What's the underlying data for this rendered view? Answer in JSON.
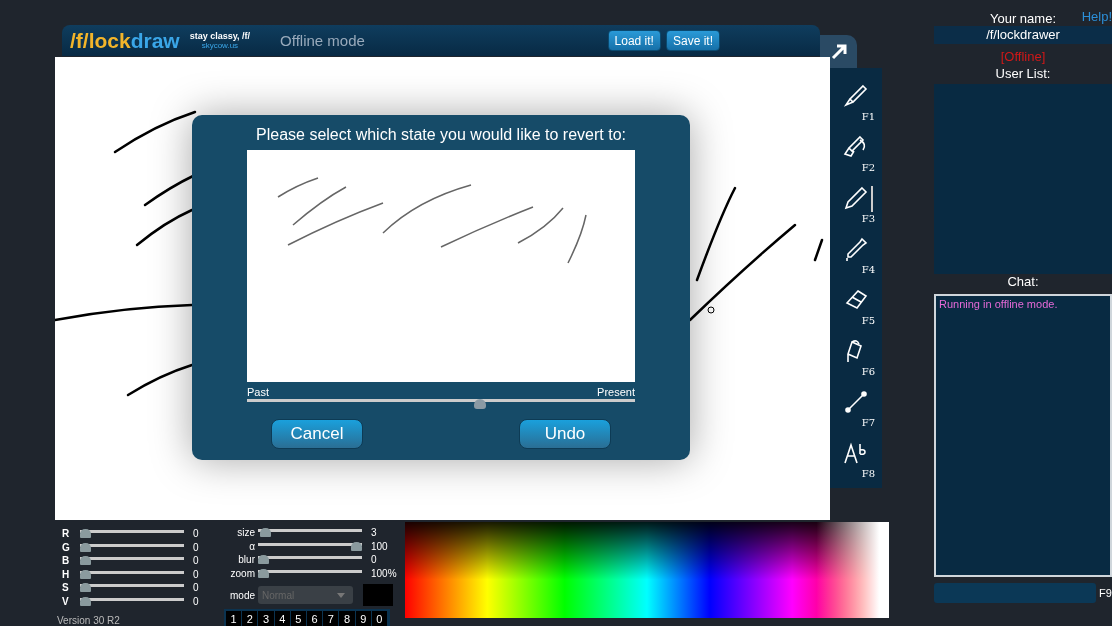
{
  "header": {
    "logo": [
      {
        "text": "/f/lock",
        "color": "#f2b52a"
      },
      {
        "text": "draw",
        "color": "#3aa6e8"
      }
    ],
    "tagline": "stay classy, /f/",
    "site": "skycow.us",
    "mode": "Offline mode",
    "buttons": [
      "Load it!",
      "Save it!"
    ]
  },
  "tools": [
    {
      "key": "F1",
      "kind": "brush",
      "selected": false
    },
    {
      "key": "F2",
      "kind": "smudge",
      "selected": false
    },
    {
      "key": "F3",
      "kind": "pencil",
      "selected": true
    },
    {
      "key": "F4",
      "kind": "dropper",
      "selected": false
    },
    {
      "key": "F5",
      "kind": "eraser",
      "selected": false
    },
    {
      "key": "F6",
      "kind": "bucket",
      "selected": false
    },
    {
      "key": "F7",
      "kind": "line",
      "selected": false
    },
    {
      "key": "F8",
      "kind": "text",
      "selected": false
    }
  ],
  "dialog": {
    "title": "Please select which state you would like to revert to:",
    "start_label": "Past",
    "end_label": "Present",
    "level": 0.6,
    "buttons": [
      "Cancel",
      "Undo"
    ]
  },
  "color_sliders": [
    {
      "label": "R",
      "level": 0,
      "reading": "0"
    },
    {
      "label": "G",
      "level": 0,
      "reading": "0"
    },
    {
      "label": "B",
      "level": 0,
      "reading": "0"
    },
    {
      "label": "H",
      "level": 0,
      "reading": "0"
    },
    {
      "label": "S",
      "level": 0,
      "reading": "0"
    },
    {
      "label": "V",
      "level": 0,
      "reading": "0"
    }
  ],
  "brush_sliders": [
    {
      "label": "size",
      "level": 0.02,
      "reading": "3"
    },
    {
      "label": "α",
      "level": 1,
      "reading": "100"
    },
    {
      "label": "blur",
      "level": 0,
      "reading": "0"
    },
    {
      "label": "zoom",
      "level": 0,
      "reading": "100%"
    }
  ],
  "mode": {
    "label": "mode",
    "value": "Normal",
    "disabled": true
  },
  "palette_slots": [
    "1",
    "2",
    "3",
    "4",
    "5",
    "6",
    "7",
    "8",
    "9",
    "0"
  ],
  "version": "Version 30 R2",
  "sidebar": {
    "name_label": "Your name:",
    "help": "Help!",
    "name": "/f/lockdrawer",
    "status": "[Offline]",
    "user_list_label": "User List:",
    "chat_label": "Chat:",
    "chat_messages": [
      "Running in offline mode."
    ],
    "chat_key": "F9"
  }
}
